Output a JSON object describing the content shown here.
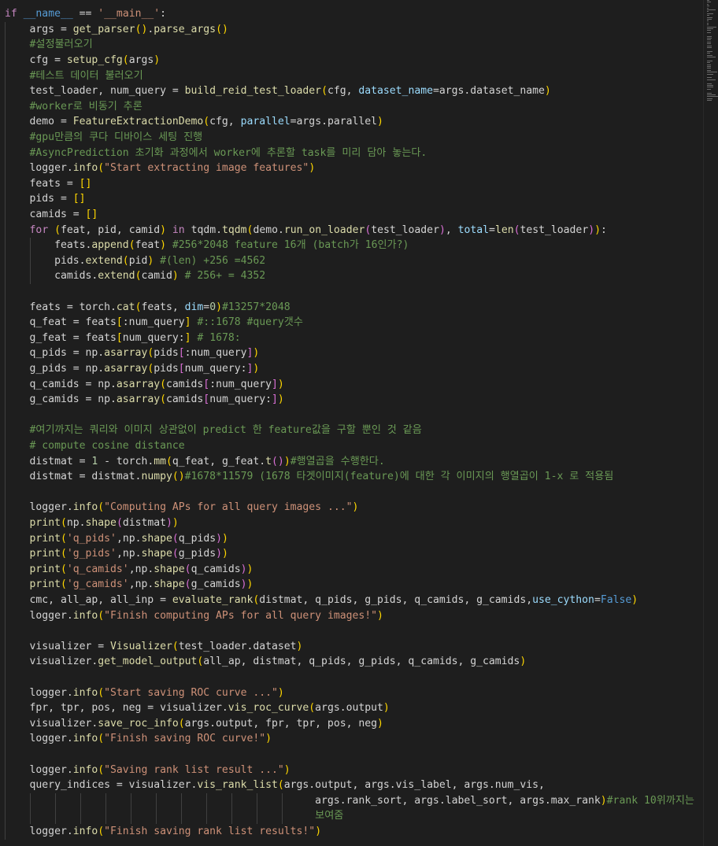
{
  "editor": {
    "lines": [
      [
        {
          "t": "if ",
          "c": "ctl"
        },
        {
          "t": "__name__",
          "c": "kw"
        },
        {
          "t": " == "
        },
        {
          "t": "'__main__'",
          "c": "str"
        },
        {
          "t": ":"
        }
      ],
      [
        {
          "t": "    args = "
        },
        {
          "t": "get_parser",
          "c": "fn"
        },
        {
          "t": "()",
          "c": "b1"
        },
        {
          "t": "."
        },
        {
          "t": "parse_args",
          "c": "fn"
        },
        {
          "t": "()",
          "c": "b1"
        }
      ],
      [
        {
          "t": "    #설정불러오기",
          "c": "cmt"
        }
      ],
      [
        {
          "t": "    cfg = "
        },
        {
          "t": "setup_cfg",
          "c": "fn"
        },
        {
          "t": "(",
          "c": "b1"
        },
        {
          "t": "args"
        },
        {
          "t": ")",
          "c": "b1"
        }
      ],
      [
        {
          "t": "    #테스트 데이터 불러오기",
          "c": "cmt"
        }
      ],
      [
        {
          "t": "    test_loader, num_query = "
        },
        {
          "t": "build_reid_test_loader",
          "c": "fn"
        },
        {
          "t": "(",
          "c": "b1"
        },
        {
          "t": "cfg, "
        },
        {
          "t": "dataset_name",
          "c": "prm"
        },
        {
          "t": "=args.dataset_name"
        },
        {
          "t": ")",
          "c": "b1"
        }
      ],
      [
        {
          "t": "    #worker로 비동기 추론",
          "c": "cmt"
        }
      ],
      [
        {
          "t": "    demo = "
        },
        {
          "t": "FeatureExtractionDemo",
          "c": "fn"
        },
        {
          "t": "(",
          "c": "b1"
        },
        {
          "t": "cfg, "
        },
        {
          "t": "parallel",
          "c": "prm"
        },
        {
          "t": "=args.parallel"
        },
        {
          "t": ")",
          "c": "b1"
        }
      ],
      [
        {
          "t": "    #gpu만큼의 쿠다 디바이스 세팅 진행",
          "c": "cmt"
        }
      ],
      [
        {
          "t": "    #AsyncPrediction 초기화 과정에서 worker에 추론할 task를 미리 담아 놓는다.",
          "c": "cmt"
        }
      ],
      [
        {
          "t": "    logger."
        },
        {
          "t": "info",
          "c": "fn"
        },
        {
          "t": "(",
          "c": "b1"
        },
        {
          "t": "\"Start extracting image features\"",
          "c": "str"
        },
        {
          "t": ")",
          "c": "b1"
        }
      ],
      [
        {
          "t": "    feats = "
        },
        {
          "t": "[]",
          "c": "b1"
        }
      ],
      [
        {
          "t": "    pids = "
        },
        {
          "t": "[]",
          "c": "b1"
        }
      ],
      [
        {
          "t": "    camids = "
        },
        {
          "t": "[]",
          "c": "b1"
        }
      ],
      [
        {
          "t": "    "
        },
        {
          "t": "for",
          "c": "ctl"
        },
        {
          "t": " "
        },
        {
          "t": "(",
          "c": "b1"
        },
        {
          "t": "feat, pid, camid"
        },
        {
          "t": ")",
          "c": "b1"
        },
        {
          "t": " "
        },
        {
          "t": "in",
          "c": "ctl"
        },
        {
          "t": " tqdm."
        },
        {
          "t": "tqdm",
          "c": "fn"
        },
        {
          "t": "(",
          "c": "b1"
        },
        {
          "t": "demo."
        },
        {
          "t": "run_on_loader",
          "c": "fn"
        },
        {
          "t": "(",
          "c": "b2"
        },
        {
          "t": "test_loader"
        },
        {
          "t": ")",
          "c": "b2"
        },
        {
          "t": ", "
        },
        {
          "t": "total",
          "c": "prm"
        },
        {
          "t": "="
        },
        {
          "t": "len",
          "c": "fn"
        },
        {
          "t": "(",
          "c": "b2"
        },
        {
          "t": "test_loader"
        },
        {
          "t": ")",
          "c": "b2"
        },
        {
          "t": ")",
          "c": "b1"
        },
        {
          "t": ":"
        }
      ],
      [
        {
          "t": "        feats."
        },
        {
          "t": "append",
          "c": "fn"
        },
        {
          "t": "(",
          "c": "b1"
        },
        {
          "t": "feat"
        },
        {
          "t": ")",
          "c": "b1"
        },
        {
          "t": " "
        },
        {
          "t": "#256*2048 feature 16개 (batch가 16인가?)",
          "c": "cmt"
        }
      ],
      [
        {
          "t": "        pids."
        },
        {
          "t": "extend",
          "c": "fn"
        },
        {
          "t": "(",
          "c": "b1"
        },
        {
          "t": "pid"
        },
        {
          "t": ")",
          "c": "b1"
        },
        {
          "t": " "
        },
        {
          "t": "#(len) +256 =4562",
          "c": "cmt"
        }
      ],
      [
        {
          "t": "        camids."
        },
        {
          "t": "extend",
          "c": "fn"
        },
        {
          "t": "(",
          "c": "b1"
        },
        {
          "t": "camid"
        },
        {
          "t": ")",
          "c": "b1"
        },
        {
          "t": " "
        },
        {
          "t": "# 256+ = 4352",
          "c": "cmt"
        }
      ],
      [],
      [
        {
          "t": "    feats = torch."
        },
        {
          "t": "cat",
          "c": "fn"
        },
        {
          "t": "(",
          "c": "b1"
        },
        {
          "t": "feats, "
        },
        {
          "t": "dim",
          "c": "prm"
        },
        {
          "t": "="
        },
        {
          "t": "0",
          "c": "num"
        },
        {
          "t": ")",
          "c": "b1"
        },
        {
          "t": "#13257*2048",
          "c": "cmt"
        }
      ],
      [
        {
          "t": "    q_feat = feats"
        },
        {
          "t": "[",
          "c": "b1"
        },
        {
          "t": ":num_query"
        },
        {
          "t": "]",
          "c": "b1"
        },
        {
          "t": " "
        },
        {
          "t": "#::1678 #query갯수",
          "c": "cmt"
        }
      ],
      [
        {
          "t": "    g_feat = feats"
        },
        {
          "t": "[",
          "c": "b1"
        },
        {
          "t": "num_query:"
        },
        {
          "t": "]",
          "c": "b1"
        },
        {
          "t": " "
        },
        {
          "t": "# 1678:",
          "c": "cmt"
        }
      ],
      [
        {
          "t": "    q_pids = np."
        },
        {
          "t": "asarray",
          "c": "fn"
        },
        {
          "t": "(",
          "c": "b1"
        },
        {
          "t": "pids"
        },
        {
          "t": "[",
          "c": "b2"
        },
        {
          "t": ":num_query"
        },
        {
          "t": "]",
          "c": "b2"
        },
        {
          "t": ")",
          "c": "b1"
        }
      ],
      [
        {
          "t": "    g_pids = np."
        },
        {
          "t": "asarray",
          "c": "fn"
        },
        {
          "t": "(",
          "c": "b1"
        },
        {
          "t": "pids"
        },
        {
          "t": "[",
          "c": "b2"
        },
        {
          "t": "num_query:"
        },
        {
          "t": "]",
          "c": "b2"
        },
        {
          "t": ")",
          "c": "b1"
        }
      ],
      [
        {
          "t": "    q_camids = np."
        },
        {
          "t": "asarray",
          "c": "fn"
        },
        {
          "t": "(",
          "c": "b1"
        },
        {
          "t": "camids"
        },
        {
          "t": "[",
          "c": "b2"
        },
        {
          "t": ":num_query"
        },
        {
          "t": "]",
          "c": "b2"
        },
        {
          "t": ")",
          "c": "b1"
        }
      ],
      [
        {
          "t": "    g_camids = np."
        },
        {
          "t": "asarray",
          "c": "fn"
        },
        {
          "t": "(",
          "c": "b1"
        },
        {
          "t": "camids"
        },
        {
          "t": "[",
          "c": "b2"
        },
        {
          "t": "num_query:"
        },
        {
          "t": "]",
          "c": "b2"
        },
        {
          "t": ")",
          "c": "b1"
        }
      ],
      [],
      [
        {
          "t": "    #여기까지는 쿼리와 이미지 상관없이 predict 한 feature값을 구할 뿐인 것 같음",
          "c": "cmt"
        }
      ],
      [
        {
          "t": "    # compute cosine distance",
          "c": "cmt"
        }
      ],
      [
        {
          "t": "    distmat = "
        },
        {
          "t": "1",
          "c": "num"
        },
        {
          "t": " - torch."
        },
        {
          "t": "mm",
          "c": "fn"
        },
        {
          "t": "(",
          "c": "b1"
        },
        {
          "t": "q_feat, g_feat."
        },
        {
          "t": "t",
          "c": "fn"
        },
        {
          "t": "()",
          "c": "b2"
        },
        {
          "t": ")",
          "c": "b1"
        },
        {
          "t": "#행열곱을 수행한다.",
          "c": "cmt"
        }
      ],
      [
        {
          "t": "    distmat = distmat."
        },
        {
          "t": "numpy",
          "c": "fn"
        },
        {
          "t": "()",
          "c": "b1"
        },
        {
          "t": "#1678*11579 (1678 타겟이미지(feature)에 대한 각 이미지의 행열곱이 1-x 로 적용됨",
          "c": "cmt"
        }
      ],
      [],
      [
        {
          "t": "    logger."
        },
        {
          "t": "info",
          "c": "fn"
        },
        {
          "t": "(",
          "c": "b1"
        },
        {
          "t": "\"Computing APs for all query images ...\"",
          "c": "str"
        },
        {
          "t": ")",
          "c": "b1"
        }
      ],
      [
        {
          "t": "    "
        },
        {
          "t": "print",
          "c": "fn"
        },
        {
          "t": "(",
          "c": "b1"
        },
        {
          "t": "np."
        },
        {
          "t": "shape",
          "c": "fn"
        },
        {
          "t": "(",
          "c": "b2"
        },
        {
          "t": "distmat"
        },
        {
          "t": ")",
          "c": "b2"
        },
        {
          "t": ")",
          "c": "b1"
        }
      ],
      [
        {
          "t": "    "
        },
        {
          "t": "print",
          "c": "fn"
        },
        {
          "t": "(",
          "c": "b1"
        },
        {
          "t": "'q_pids'",
          "c": "str"
        },
        {
          "t": ",np."
        },
        {
          "t": "shape",
          "c": "fn"
        },
        {
          "t": "(",
          "c": "b2"
        },
        {
          "t": "q_pids"
        },
        {
          "t": ")",
          "c": "b2"
        },
        {
          "t": ")",
          "c": "b1"
        }
      ],
      [
        {
          "t": "    "
        },
        {
          "t": "print",
          "c": "fn"
        },
        {
          "t": "(",
          "c": "b1"
        },
        {
          "t": "'g_pids'",
          "c": "str"
        },
        {
          "t": ",np."
        },
        {
          "t": "shape",
          "c": "fn"
        },
        {
          "t": "(",
          "c": "b2"
        },
        {
          "t": "g_pids"
        },
        {
          "t": ")",
          "c": "b2"
        },
        {
          "t": ")",
          "c": "b1"
        }
      ],
      [
        {
          "t": "    "
        },
        {
          "t": "print",
          "c": "fn"
        },
        {
          "t": "(",
          "c": "b1"
        },
        {
          "t": "'q_camids'",
          "c": "str"
        },
        {
          "t": ",np."
        },
        {
          "t": "shape",
          "c": "fn"
        },
        {
          "t": "(",
          "c": "b2"
        },
        {
          "t": "q_camids"
        },
        {
          "t": ")",
          "c": "b2"
        },
        {
          "t": ")",
          "c": "b1"
        }
      ],
      [
        {
          "t": "    "
        },
        {
          "t": "print",
          "c": "fn"
        },
        {
          "t": "(",
          "c": "b1"
        },
        {
          "t": "'g_camids'",
          "c": "str"
        },
        {
          "t": ",np."
        },
        {
          "t": "shape",
          "c": "fn"
        },
        {
          "t": "(",
          "c": "b2"
        },
        {
          "t": "g_camids"
        },
        {
          "t": ")",
          "c": "b2"
        },
        {
          "t": ")",
          "c": "b1"
        }
      ],
      [
        {
          "t": "    cmc, all_ap, all_inp = "
        },
        {
          "t": "evaluate_rank",
          "c": "fn"
        },
        {
          "t": "(",
          "c": "b1"
        },
        {
          "t": "distmat, q_pids, g_pids, q_camids, g_camids,"
        },
        {
          "t": "use_cython",
          "c": "prm"
        },
        {
          "t": "="
        },
        {
          "t": "False",
          "c": "kw"
        },
        {
          "t": ")",
          "c": "b1"
        }
      ],
      [
        {
          "t": "    logger."
        },
        {
          "t": "info",
          "c": "fn"
        },
        {
          "t": "(",
          "c": "b1"
        },
        {
          "t": "\"Finish computing APs for all query images!\"",
          "c": "str"
        },
        {
          "t": ")",
          "c": "b1"
        }
      ],
      [],
      [
        {
          "t": "    visualizer = "
        },
        {
          "t": "Visualizer",
          "c": "fn"
        },
        {
          "t": "(",
          "c": "b1"
        },
        {
          "t": "test_loader.dataset"
        },
        {
          "t": ")",
          "c": "b1"
        }
      ],
      [
        {
          "t": "    visualizer."
        },
        {
          "t": "get_model_output",
          "c": "fn"
        },
        {
          "t": "(",
          "c": "b1"
        },
        {
          "t": "all_ap, distmat, q_pids, g_pids, q_camids, g_camids"
        },
        {
          "t": ")",
          "c": "b1"
        }
      ],
      [],
      [
        {
          "t": "    logger."
        },
        {
          "t": "info",
          "c": "fn"
        },
        {
          "t": "(",
          "c": "b1"
        },
        {
          "t": "\"Start saving ROC curve ...\"",
          "c": "str"
        },
        {
          "t": ")",
          "c": "b1"
        }
      ],
      [
        {
          "t": "    fpr, tpr, pos, neg = visualizer."
        },
        {
          "t": "vis_roc_curve",
          "c": "fn"
        },
        {
          "t": "(",
          "c": "b1"
        },
        {
          "t": "args.output"
        },
        {
          "t": ")",
          "c": "b1"
        }
      ],
      [
        {
          "t": "    visualizer."
        },
        {
          "t": "save_roc_info",
          "c": "fn"
        },
        {
          "t": "(",
          "c": "b1"
        },
        {
          "t": "args.output, fpr, tpr, pos, neg"
        },
        {
          "t": ")",
          "c": "b1"
        }
      ],
      [
        {
          "t": "    logger."
        },
        {
          "t": "info",
          "c": "fn"
        },
        {
          "t": "(",
          "c": "b1"
        },
        {
          "t": "\"Finish saving ROC curve!\"",
          "c": "str"
        },
        {
          "t": ")",
          "c": "b1"
        }
      ],
      [],
      [
        {
          "t": "    logger."
        },
        {
          "t": "info",
          "c": "fn"
        },
        {
          "t": "(",
          "c": "b1"
        },
        {
          "t": "\"Saving rank list result ...\"",
          "c": "str"
        },
        {
          "t": ")",
          "c": "b1"
        }
      ],
      [
        {
          "t": "    query_indices = visualizer."
        },
        {
          "t": "vis_rank_list",
          "c": "fn"
        },
        {
          "t": "(",
          "c": "b1"
        },
        {
          "t": "args.output, args.vis_label, args.num_vis,"
        }
      ],
      [
        {
          "t": "                                                  args.rank_sort, args.label_sort, args.max_rank"
        },
        {
          "t": ")",
          "c": "b1"
        },
        {
          "t": "#rank 10위까지는",
          "c": "cmt"
        }
      ],
      [
        {
          "t": "                                                  보여줌",
          "c": "cmt"
        }
      ],
      [
        {
          "t": "    logger."
        },
        {
          "t": "info",
          "c": "fn"
        },
        {
          "t": "(",
          "c": "b1"
        },
        {
          "t": "\"Finish saving rank list results!\"",
          "c": "str"
        },
        {
          "t": ")",
          "c": "b1"
        }
      ]
    ]
  },
  "colors": {
    "background": "#1e1e1e",
    "keyword": "#569cd6",
    "control": "#c586c0",
    "function": "#dcdcaa",
    "string": "#ce9178",
    "comment": "#6a9955",
    "number": "#b5cea8",
    "parameter": "#9cdcfe",
    "bracket_level_1": "#ffd700",
    "bracket_level_2": "#da70d6"
  }
}
